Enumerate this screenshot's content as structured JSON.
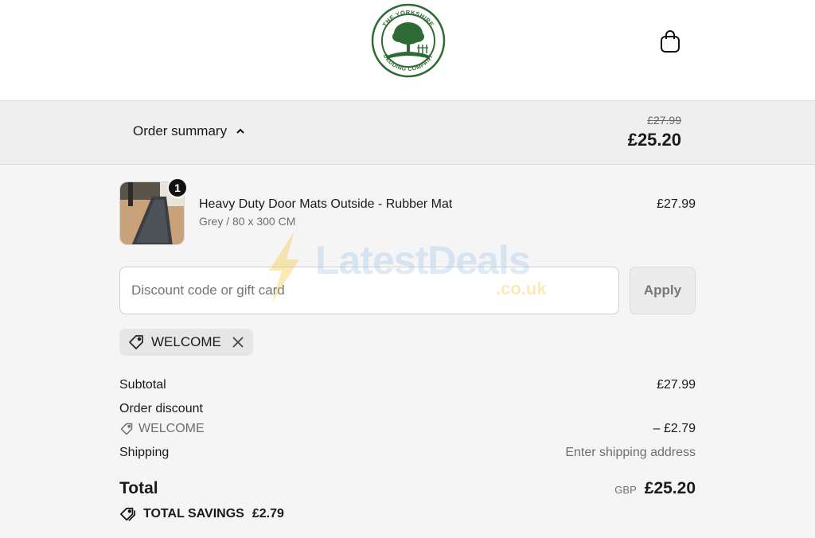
{
  "header": {
    "logo_text_top": "THE YORKSHIRE",
    "logo_text_bottom": "BEDDING COMPANY",
    "cart_icon": "shopping-bag-icon"
  },
  "summary_bar": {
    "toggle_label": "Order summary",
    "original_price": "£27.99",
    "discounted_price": "£25.20"
  },
  "product": {
    "title": "Heavy Duty Door Mats Outside - Rubber Mat",
    "variant": "Grey / 80 x 300 CM",
    "price": "£27.99",
    "quantity": "1"
  },
  "discount": {
    "placeholder": "Discount code or gift card",
    "apply_label": "Apply",
    "applied_code": "WELCOME"
  },
  "totals": {
    "subtotal_label": "Subtotal",
    "subtotal_value": "£27.99",
    "order_discount_label": "Order discount",
    "order_discount_code": "WELCOME",
    "order_discount_value": "– £2.79",
    "shipping_label": "Shipping",
    "shipping_value": "Enter shipping address",
    "total_label": "Total",
    "total_currency": "GBP",
    "total_value": "£25.20",
    "savings_label": "TOTAL SAVINGS",
    "savings_value": "£2.79"
  },
  "watermark": {
    "text": "LatestDeals",
    "sub": ".co.uk"
  },
  "colors": {
    "brand_green": "#2e6b34",
    "text": "#1a1a1a",
    "muted": "#6e6e6e"
  }
}
